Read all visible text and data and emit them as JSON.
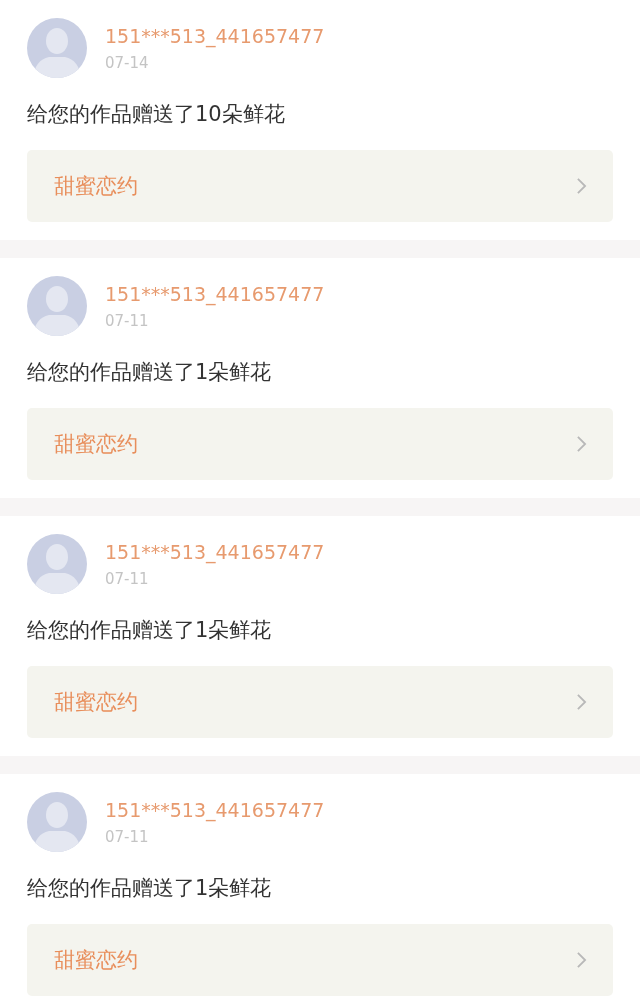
{
  "notifications": [
    {
      "user": "151***513_441657477",
      "date": "07-14",
      "message": "给您的作品赠送了10朵鲜花",
      "work_title": "甜蜜恋约"
    },
    {
      "user": "151***513_441657477",
      "date": "07-11",
      "message": "给您的作品赠送了1朵鲜花",
      "work_title": "甜蜜恋约"
    },
    {
      "user": "151***513_441657477",
      "date": "07-11",
      "message": "给您的作品赠送了1朵鲜花",
      "work_title": "甜蜜恋约"
    },
    {
      "user": "151***513_441657477",
      "date": "07-11",
      "message": "给您的作品赠送了1朵鲜花",
      "work_title": "甜蜜恋约"
    }
  ]
}
